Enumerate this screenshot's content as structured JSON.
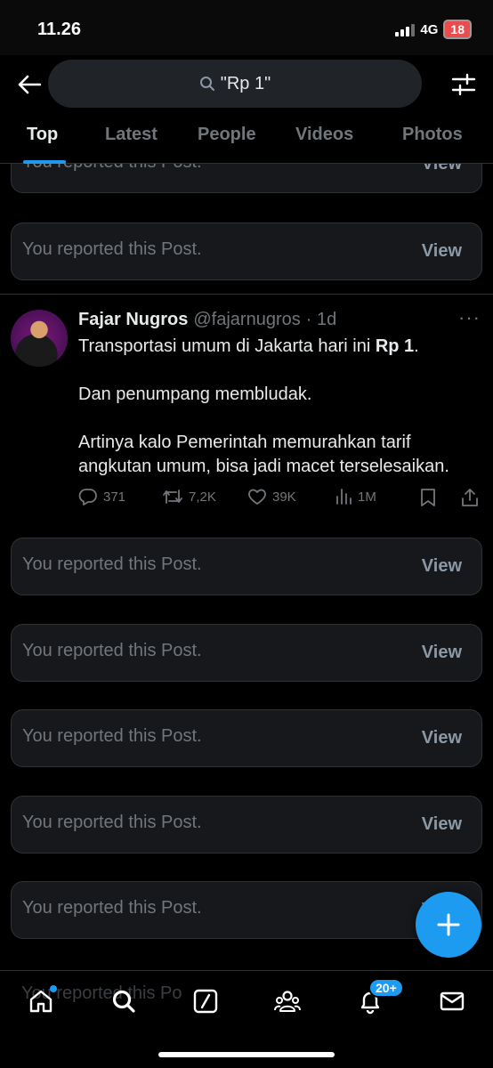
{
  "status": {
    "time": "11.26",
    "network": "4G",
    "battery": "18"
  },
  "search": {
    "query": "\"Rp 1\""
  },
  "tabs": [
    {
      "label": "Top"
    },
    {
      "label": "Latest"
    },
    {
      "label": "People"
    },
    {
      "label": "Videos"
    },
    {
      "label": "Photos"
    }
  ],
  "reported": {
    "text": "You reported this Post.",
    "view_label": "View",
    "partial_text": "You reported this Po"
  },
  "post": {
    "name": "Fajar Nugros",
    "handle": "@fajarnugros",
    "time": "· 1d",
    "line1_prefix": "Transportasi umum di Jakarta hari ini ",
    "line1_bold": "Rp 1",
    "line1_suffix": ".",
    "para2": "Dan penumpang membludak.",
    "para3": "Artinya kalo Pemerintah memurahkan tarif angkutan umum, bisa jadi macet terselesaikan.",
    "replies": "371",
    "reposts": "7,2K",
    "likes": "39K",
    "views": "1M"
  },
  "nav": {
    "notifications_badge": "20+"
  },
  "colors": {
    "accent": "#1d9bf0",
    "background": "#000000",
    "card": "#16181c",
    "muted": "#71767b"
  }
}
